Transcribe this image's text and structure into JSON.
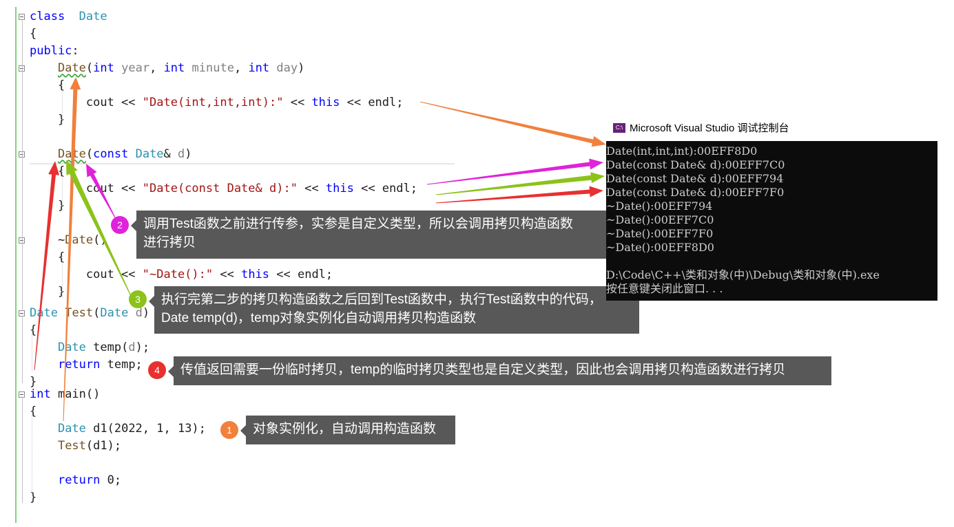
{
  "console": {
    "title": "Microsoft Visual Studio 调试控制台",
    "icon": "visual-studio-icon",
    "lines": [
      "Date(int,int,int):00EFF8D0",
      "Date(const Date& d):00EFF7C0",
      "Date(const Date& d):00EFF794",
      "Date(const Date& d):00EFF7F0",
      "~Date():00EFF794",
      "~Date():00EFF7C0",
      "~Date():00EFF7F0",
      "~Date():00EFF8D0",
      "",
      "D:\\Code\\C++\\类和对象(中)\\Debug\\类和对象(中).exe",
      "按任意键关闭此窗口. . ."
    ]
  },
  "callouts": [
    {
      "number": "1",
      "color": "#f0803c",
      "text_lines": [
        "对象实例化，自动调用构造函数"
      ]
    },
    {
      "number": "2",
      "color": "#e022d8",
      "text_lines": [
        "调用Test函数之前进行传参，实参是自定义类型，所以会调用拷贝构造函数",
        "进行拷贝"
      ]
    },
    {
      "number": "3",
      "color": "#8cc21a",
      "text_lines": [
        "执行完第二步的拷贝构造函数之后回到Test函数中，执行Test函数中的代码，",
        "Date temp(d)，temp对象实例化自动调用拷贝构造函数"
      ]
    },
    {
      "number": "4",
      "color": "#e83030",
      "text_lines": [
        "传值返回需要一份临时拷贝，temp的临时拷贝类型也是自定义类型，因此也会调用拷贝构造函数进行拷贝"
      ]
    }
  ],
  "colors": {
    "keyword": "#0000ff",
    "type": "#2b91af",
    "string": "#a31515",
    "param": "#808080",
    "console_bg": "#0c0c0c",
    "callout_bg": "#585858",
    "arrow_orange": "#f0803c",
    "arrow_magenta": "#e022d8",
    "arrow_green": "#8cc21a",
    "arrow_red": "#e83030"
  },
  "code": [
    [
      [
        "kw",
        "class"
      ],
      [
        "",
        "  "
      ],
      [
        "ty",
        "Date"
      ]
    ],
    [
      [
        "",
        "{"
      ]
    ],
    [
      [
        "kw",
        "public"
      ],
      [
        "",
        ":"
      ]
    ],
    [
      [
        "",
        "    "
      ],
      [
        "fnsq",
        "Date"
      ],
      [
        "",
        "("
      ],
      [
        "kw",
        "int"
      ],
      [
        "",
        " "
      ],
      [
        "pm",
        "year"
      ],
      [
        "",
        ", "
      ],
      [
        "kw",
        "int"
      ],
      [
        "",
        " "
      ],
      [
        "pm",
        "minute"
      ],
      [
        "",
        ", "
      ],
      [
        "kw",
        "int"
      ],
      [
        "",
        " "
      ],
      [
        "pm",
        "day"
      ],
      [
        "",
        ")"
      ]
    ],
    [
      [
        "",
        "    {"
      ]
    ],
    [
      [
        "",
        "        cout << "
      ],
      [
        "st",
        "\"Date(int,int,int):\""
      ],
      [
        "",
        " << "
      ],
      [
        "kw",
        "this"
      ],
      [
        "",
        " << endl;"
      ]
    ],
    [
      [
        "",
        "    }"
      ]
    ],
    [
      [
        "",
        ""
      ]
    ],
    [
      [
        "",
        "    "
      ],
      [
        "fnsq",
        "Date"
      ],
      [
        "",
        "("
      ],
      [
        "kw",
        "const"
      ],
      [
        "",
        " "
      ],
      [
        "ty",
        "Date"
      ],
      [
        "",
        "& "
      ],
      [
        "pm",
        "d"
      ],
      [
        "",
        ")"
      ]
    ],
    [
      [
        "",
        "    {"
      ]
    ],
    [
      [
        "",
        "        cout << "
      ],
      [
        "st",
        "\"Date(const Date& d):\""
      ],
      [
        "",
        " << "
      ],
      [
        "kw",
        "this"
      ],
      [
        "",
        " << endl;"
      ]
    ],
    [
      [
        "",
        "    }"
      ]
    ],
    [
      [
        "",
        ""
      ]
    ],
    [
      [
        "",
        "    ~"
      ],
      [
        "fn",
        "Date"
      ],
      [
        "",
        "()"
      ]
    ],
    [
      [
        "",
        "    {"
      ]
    ],
    [
      [
        "",
        "        cout << "
      ],
      [
        "st",
        "\"~Date():\""
      ],
      [
        "",
        " << "
      ],
      [
        "kw",
        "this"
      ],
      [
        "",
        " << endl;"
      ]
    ],
    [
      [
        "",
        "    }"
      ]
    ],
    [
      [
        "ty",
        "Date"
      ],
      [
        "",
        " "
      ],
      [
        "fn",
        "Test"
      ],
      [
        "",
        "("
      ],
      [
        "ty",
        "Date"
      ],
      [
        "",
        " "
      ],
      [
        "pm",
        "d"
      ],
      [
        "",
        ")"
      ]
    ],
    [
      [
        "",
        "{"
      ]
    ],
    [
      [
        "",
        "    "
      ],
      [
        "ty",
        "Date"
      ],
      [
        "",
        " temp("
      ],
      [
        "pm",
        "d"
      ],
      [
        "",
        ");"
      ]
    ],
    [
      [
        "",
        "    "
      ],
      [
        "kw",
        "return"
      ],
      [
        "",
        " temp;"
      ]
    ],
    [
      [
        "",
        "}"
      ]
    ],
    [
      [
        "kw",
        "int"
      ],
      [
        "",
        " main()"
      ]
    ],
    [
      [
        "",
        "{"
      ]
    ],
    [
      [
        "",
        "    "
      ],
      [
        "ty",
        "Date"
      ],
      [
        "",
        " d1(2022, 1, 13);"
      ]
    ],
    [
      [
        "",
        "    "
      ],
      [
        "fn",
        "Test"
      ],
      [
        "",
        "(d1);"
      ]
    ],
    [
      [
        "",
        ""
      ]
    ],
    [
      [
        "",
        "    "
      ],
      [
        "kw",
        "return"
      ],
      [
        "",
        " 0;"
      ]
    ],
    [
      [
        "",
        "}"
      ]
    ]
  ]
}
